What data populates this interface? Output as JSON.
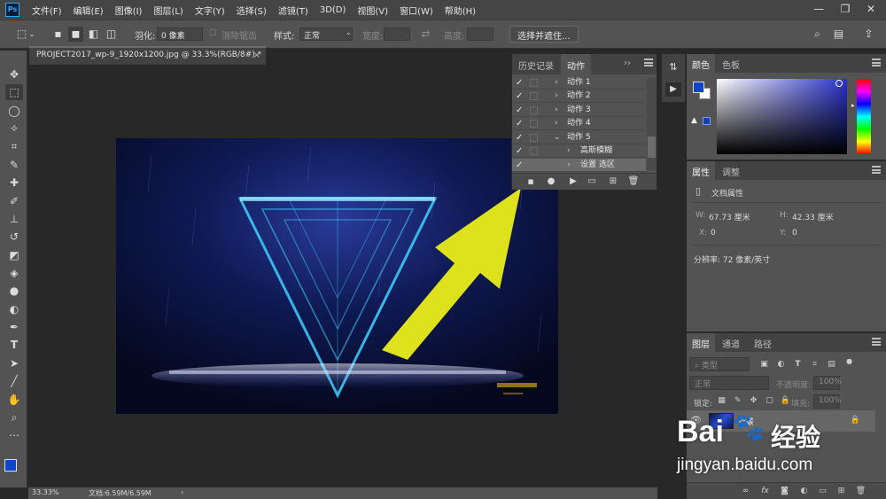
{
  "app": {
    "logo": "Ps",
    "menu": [
      "文件(F)",
      "编辑(E)",
      "图像(I)",
      "图层(L)",
      "文字(Y)",
      "选择(S)",
      "滤镜(T)",
      "3D(D)",
      "视图(V)",
      "窗口(W)",
      "帮助(H)"
    ],
    "window_controls": {
      "minimize": "—",
      "restore": "❐",
      "close": "✕"
    }
  },
  "options_bar": {
    "feather_label": "羽化:",
    "feather_value": "0 像素",
    "anti_alias_label": "消除锯齿",
    "style_label": "样式:",
    "style_value": "正常",
    "width_label": "宽度:",
    "height_label": "高度:",
    "select_mask_button": "选择并遮住..."
  },
  "document": {
    "tab_title": "PROJECT2017_wp-9_1920x1200.jpg @ 33.3%(RGB/8#) *",
    "close": "×"
  },
  "status": {
    "zoom": "33.33%",
    "doc_info": "文档:6.59M/6.59M",
    "arrow": "›"
  },
  "actions_panel": {
    "tabs": [
      "历史记录",
      "动作"
    ],
    "expand": "››",
    "items": [
      {
        "label": "动作 1",
        "expanded": false
      },
      {
        "label": "动作 2",
        "expanded": false
      },
      {
        "label": "动作 3",
        "expanded": false
      },
      {
        "label": "动作 4",
        "expanded": false
      },
      {
        "label": "动作 5",
        "expanded": true
      },
      {
        "label": "高斯模糊",
        "child": true
      },
      {
        "label": "设置 选区",
        "child": true
      }
    ]
  },
  "color_panel": {
    "tabs": [
      "颜色",
      "色板"
    ],
    "foreground": "#0f45c8",
    "hue_base": "#2a33cc"
  },
  "properties_panel": {
    "tabs": [
      "属性",
      "调整"
    ],
    "heading": "文档属性",
    "w_label": "W:",
    "w_value": "67.73 厘米",
    "h_label": "H:",
    "h_value": "42.33 厘米",
    "x_label": "X:",
    "x_value": "0",
    "y_label": "Y:",
    "y_value": "0",
    "resolution": "分辨率: 72 像素/英寸"
  },
  "layers_panel": {
    "tabs": [
      "图层",
      "通道",
      "路径"
    ],
    "filter_kind": "类型",
    "blend_mode": "正常",
    "opacity_label": "不透明度:",
    "opacity_value": "100%",
    "lock_label": "锁定:",
    "fill_label": "填充:",
    "fill_value": "100%",
    "layer_name": "背景"
  },
  "watermark": {
    "brand": "Bai",
    "brand_cn": "经验",
    "url": "jingyan.baidu.com"
  },
  "colors": {
    "arrow": "#dde21c",
    "accent": "#31a8ff"
  }
}
